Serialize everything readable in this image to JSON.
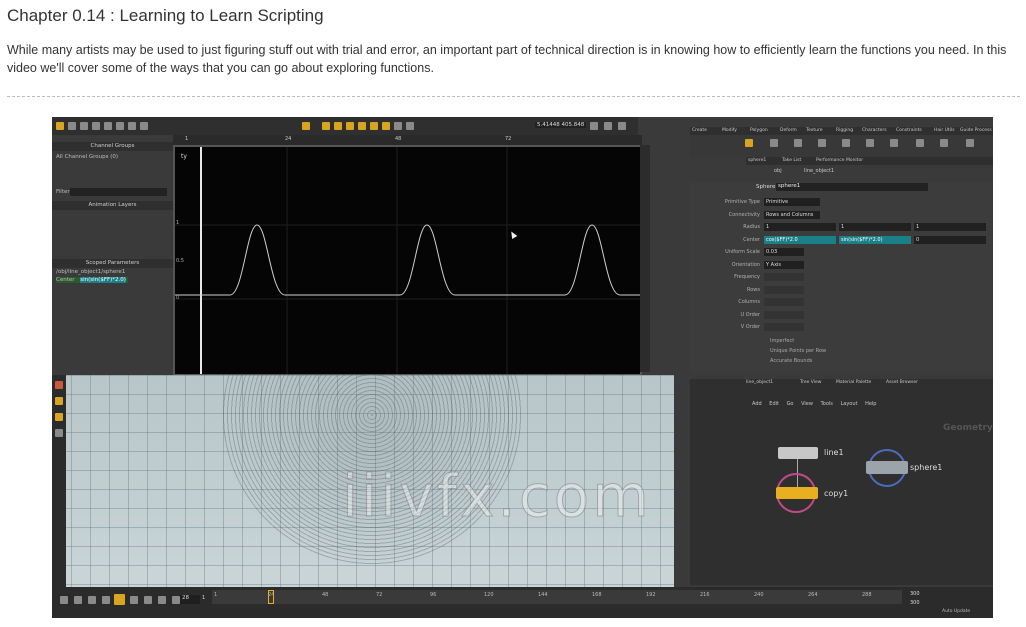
{
  "article": {
    "title": "Chapter 0.14 : Learning to Learn Scripting",
    "description": "While many artists may be used to just figuring stuff out with trial and error, an important part of technical direction is in knowing how to efficiently learn the functions you need. In this video we'll cover some of the ways that you can go about exploring functions."
  },
  "screenshot": {
    "coord_readout": "5.41448 405.848",
    "channel_panel": {
      "header": "Channel Groups",
      "group": "All Channel Groups (0)",
      "filter_label": "Filter",
      "animation_layers": "Animation Layers",
      "scoped_parameters": "Scoped Parameters",
      "scoped_path": "/obj/line_object1/sphere1",
      "scoped_param": "Center",
      "scoped_expr": "sin(sin($FF)*2.0)"
    },
    "graph": {
      "axis_label": "ty",
      "ruler_ticks": [
        "1",
        "24",
        "48",
        "72"
      ],
      "y_ticks": [
        "1",
        "0.5",
        "0"
      ]
    },
    "shelf_tabs": [
      "Create",
      "Modify",
      "Polygon",
      "Deform",
      "Texture",
      "Rigging",
      "Characters",
      "Constraints",
      "Hair Utils",
      "Guide Process"
    ],
    "pane_tabs": [
      "sphere1",
      "Take List",
      "Performance Monitor"
    ],
    "path": [
      "obj",
      "line_object1"
    ],
    "param_node": {
      "type_label": "Sphere",
      "name": "sphere1"
    },
    "params": [
      {
        "label": "Primitive Type",
        "value": "Primitive"
      },
      {
        "label": "Connectivity",
        "value": "Rows and Columns"
      },
      {
        "label": "Radius",
        "values": [
          "1",
          "1",
          "1"
        ]
      },
      {
        "label": "Center",
        "values": [
          "cos($FF)*2.0",
          "sin(sin($FF)*2.0)",
          "0"
        ]
      },
      {
        "label": "Uniform Scale",
        "value": "0.03"
      },
      {
        "label": "Orientation",
        "value": "Y Axis"
      },
      {
        "label": "Frequency",
        "value": ""
      },
      {
        "label": "Rows",
        "value": ""
      },
      {
        "label": "Columns",
        "value": ""
      },
      {
        "label": "U Order",
        "value": ""
      },
      {
        "label": "V Order",
        "value": ""
      }
    ],
    "param_checks": [
      "Imperfect",
      "Unique Points per Row",
      "Accurate Bounds"
    ],
    "network_tabs": [
      "line_object1",
      "Tree View",
      "Material Palette",
      "Asset Browser"
    ],
    "network_menu": [
      "Add",
      "Edit",
      "Go",
      "View",
      "Tools",
      "Layout",
      "Help"
    ],
    "network_context": "Geometry",
    "nodes": {
      "line": "line1",
      "sphere": "sphere1",
      "copy": "copy1"
    },
    "timeline": {
      "frame": "28",
      "start": "1",
      "end_a": "300",
      "end_b": "300",
      "ruler_ticks": [
        "1",
        "24",
        "48",
        "72",
        "96",
        "120",
        "144",
        "168",
        "192",
        "216",
        "240",
        "264",
        "288"
      ],
      "auto_update": "Auto Update"
    },
    "watermark": "iiivfx.com"
  },
  "colors": {
    "expr_field": "#1a7f86",
    "accent_yellow": "#d9a520",
    "curve": "#cfcfcf"
  }
}
